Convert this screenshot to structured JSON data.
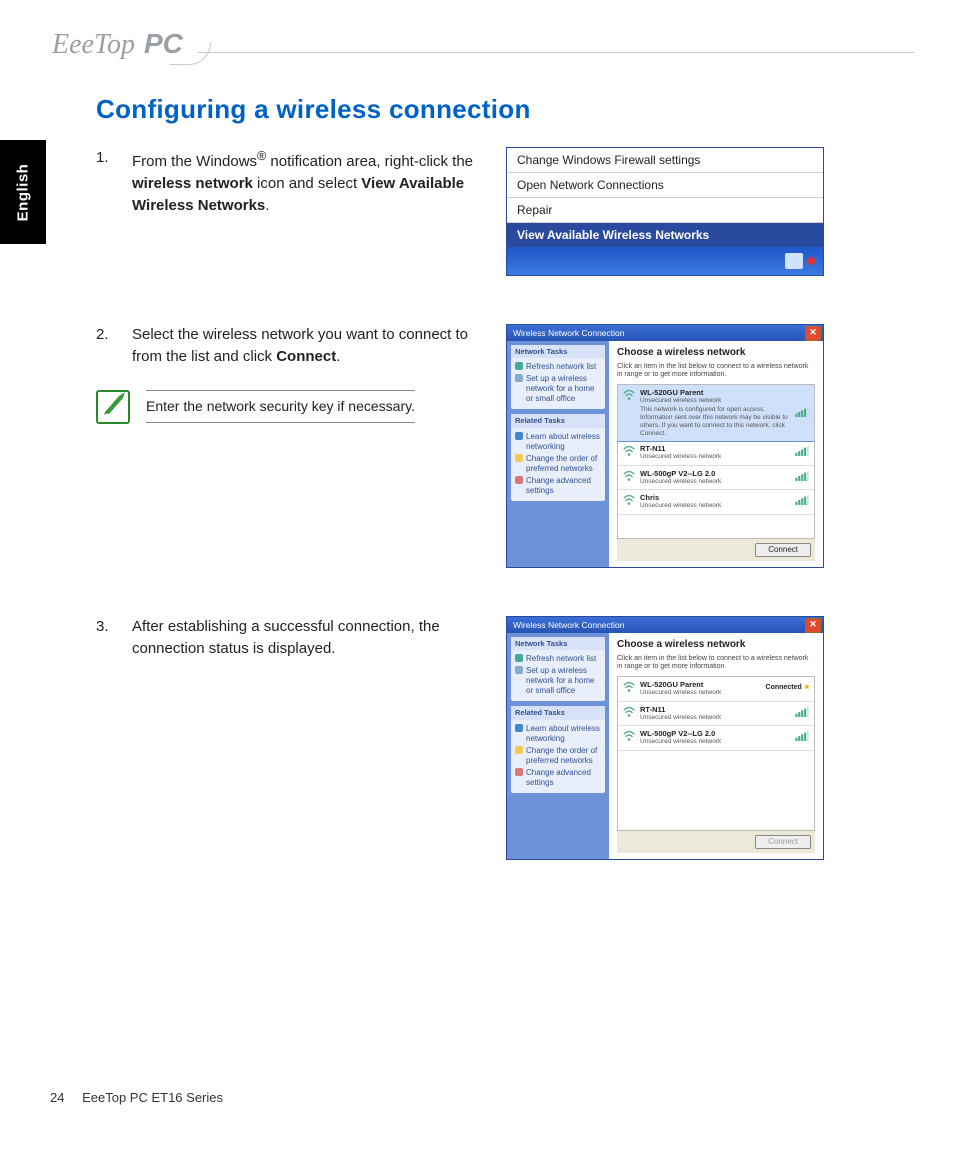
{
  "brand": "EeeTop",
  "brand_suffix": "PC",
  "lang_tab": "English",
  "heading": "Configuring a wireless connection",
  "steps": {
    "s1_num": "1.",
    "s1_a": "From the Windows",
    "s1_reg": "®",
    "s1_b": " notification area, right-click the ",
    "s1_bold1": "wireless network",
    "s1_c": " icon and select ",
    "s1_bold2": "View Available Wireless Networks",
    "s1_d": ".",
    "s2_num": "2.",
    "s2_a": "Select the wireless network you want to connect to from the list and click ",
    "s2_bold": "Connect",
    "s2_b": ".",
    "tip": "Enter the network security key if necessary.",
    "s3_num": "3.",
    "s3_text": "After establishing a successful connection, the connection status is displayed."
  },
  "fig1": {
    "items": [
      "Change Windows Firewall settings",
      "Open Network Connections",
      "Repair",
      "View Available Wireless Networks"
    ]
  },
  "win": {
    "title": "Wireless Network Connection",
    "choose": "Choose a wireless network",
    "sub": "Click an item in the list below to connect to a wireless network in range or to get more information.",
    "side1_h": "Network Tasks",
    "side1_a": "Refresh network list",
    "side1_b": "Set up a wireless network for a home or small office",
    "side2_h": "Related Tasks",
    "side2_a": "Learn about wireless networking",
    "side2_b": "Change the order of preferred networks",
    "side2_c": "Change advanced settings",
    "sel_desc": "This network is configured for open access. Information sent over this network may be visible to others. If you want to connect to this network, click Connect.",
    "unsec": "Unsecured wireless network",
    "connect": "Connect",
    "connected": "Connected"
  },
  "nets2": [
    {
      "name": "WL-520GU Parent",
      "sel": true
    },
    {
      "name": "RT-N11"
    },
    {
      "name": "WL-500gP V2--LG 2.0"
    },
    {
      "name": "Chris"
    }
  ],
  "nets3": [
    {
      "name": "WL-520GU Parent",
      "connected": true
    },
    {
      "name": "RT-N11"
    },
    {
      "name": "WL-500gP V2--LG 2.0"
    }
  ],
  "footer": {
    "page": "24",
    "title": "EeeTop PC ET16 Series"
  }
}
